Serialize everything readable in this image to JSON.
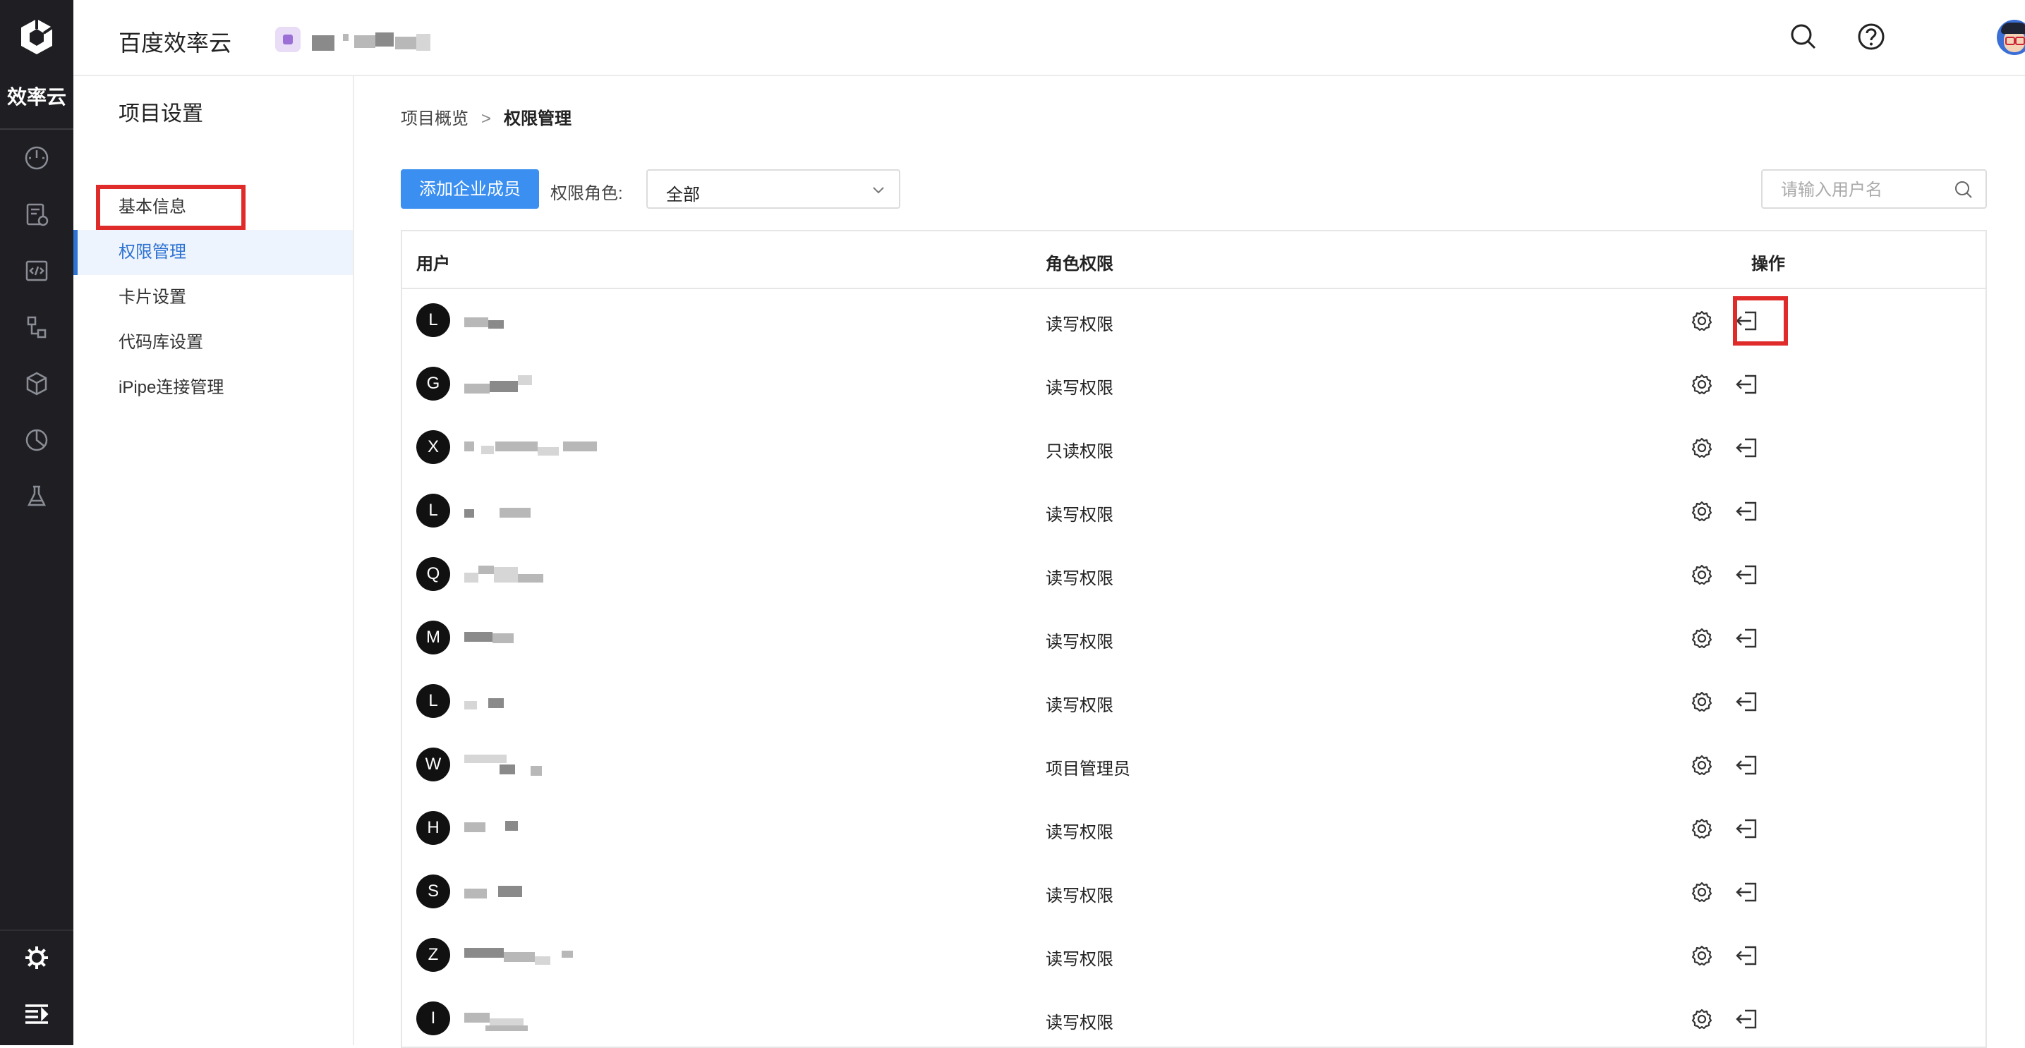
{
  "rail": {
    "brand": "效率云",
    "icons": [
      "dashboard-icon",
      "requirements-icon",
      "code-icon",
      "pipeline-icon",
      "artifact-icon",
      "report-icon",
      "lab-icon"
    ],
    "bottom_icons": [
      "settings-gear-icon",
      "collapse-menu-icon"
    ]
  },
  "header": {
    "app_title": "百度效率云",
    "icons": [
      "search-icon",
      "help-icon",
      "user-avatar",
      "chevron-down-icon"
    ]
  },
  "sidebar": {
    "title": "项目设置",
    "items": [
      {
        "label": "基本信息"
      },
      {
        "label": "权限管理",
        "active": true
      },
      {
        "label": "卡片设置"
      },
      {
        "label": "代码库设置"
      },
      {
        "label": "iPipe连接管理"
      }
    ]
  },
  "breadcrumb": {
    "parent": "项目概览",
    "separator": ">",
    "current": "权限管理"
  },
  "toolbar": {
    "add_button": "添加企业成员",
    "role_label": "权限角色:",
    "role_selected": "全部",
    "search_placeholder": "请输入用户名"
  },
  "table": {
    "columns": [
      "用户",
      "角色权限",
      "操作"
    ],
    "rows": [
      {
        "initial": "L",
        "role": "读写权限"
      },
      {
        "initial": "G",
        "role": "读写权限"
      },
      {
        "initial": "X",
        "role": "只读权限"
      },
      {
        "initial": "L",
        "role": "读写权限"
      },
      {
        "initial": "Q",
        "role": "读写权限"
      },
      {
        "initial": "M",
        "role": "读写权限"
      },
      {
        "initial": "L",
        "role": "读写权限"
      },
      {
        "initial": "W",
        "role": "项目管理员"
      },
      {
        "initial": "H",
        "role": "读写权限"
      },
      {
        "initial": "S",
        "role": "读写权限"
      },
      {
        "initial": "Z",
        "role": "读写权限"
      },
      {
        "initial": "I",
        "role": "读写权限"
      }
    ],
    "row_actions": [
      "settings-icon",
      "exit-icon"
    ]
  },
  "colors": {
    "rail_bg": "#1f1f23",
    "accent": "#2e72d2",
    "button": "#3b8ff0",
    "highlight": "#e02b2b"
  }
}
